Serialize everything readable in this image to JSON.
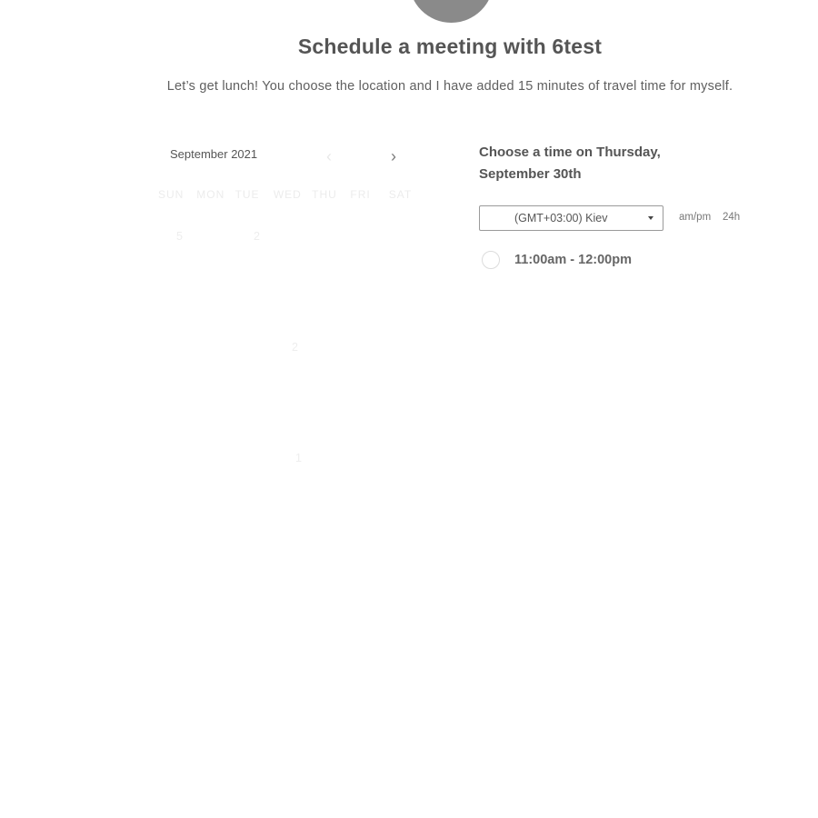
{
  "header": {
    "title": "Schedule a meeting with 6test",
    "description": "Let’s get lunch! You choose the location and I have added 15 minutes of travel time for myself."
  },
  "calendar": {
    "month": "September 2021",
    "prev_glyph": "‹",
    "next_glyph": "›",
    "weekdays": [
      "SUN",
      "MON",
      "TUE",
      "WED",
      "THU",
      "FRI",
      "SAT"
    ],
    "visible_days": [
      "5",
      "2",
      "2",
      "1"
    ]
  },
  "time_panel": {
    "heading": "Choose a time on Thursday, September 30th",
    "timezone": "(GMT+03:00) Kiev",
    "format_ampm": "am/pm",
    "format_24h": "24h",
    "slots": [
      "11:00am - 12:00pm"
    ]
  },
  "colors": {
    "avatar": "#8a8a8a",
    "text": "#555555"
  },
  "icons": {
    "prev": "chevron-left-icon",
    "next": "chevron-right-icon",
    "dropdown": "caret-down-icon"
  }
}
